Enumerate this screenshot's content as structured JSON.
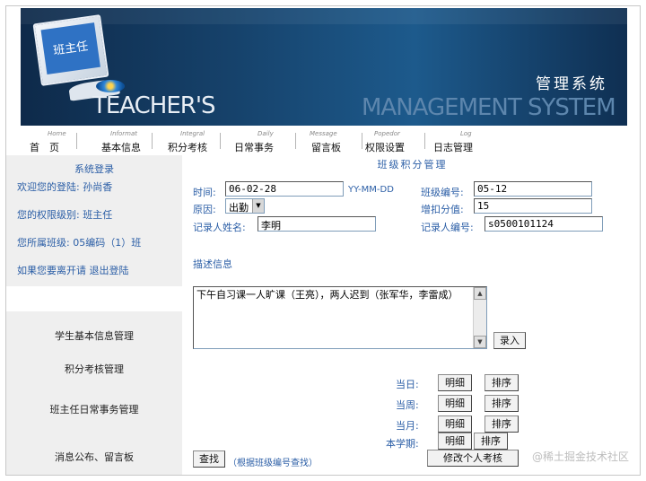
{
  "banner": {
    "monitor_text": "班主任",
    "brand_en_1": "TEACHER'S",
    "brand_en_2": "MANAGEMENT SYSTEM",
    "brand_cn": "管理系统"
  },
  "nav": {
    "items": [
      {
        "en": "Home",
        "cn": "首　页"
      },
      {
        "en": "Informat",
        "cn": "基本信息"
      },
      {
        "en": "Integral",
        "cn": "积分考核"
      },
      {
        "en": "Daily",
        "cn": "日常事务"
      },
      {
        "en": "Message",
        "cn": "留言板"
      },
      {
        "en": "Popedor",
        "cn": "权限设置"
      },
      {
        "en": "Log",
        "cn": "日志管理"
      }
    ]
  },
  "sidebar": {
    "login_title": "系统登录",
    "welcome_label": "欢迎您的登陆:",
    "welcome_user": "孙尚香",
    "level_label": "您的权限级别:",
    "level_value": "班主任",
    "class_label": "您所属班级:",
    "class_value": "05编码（1）班",
    "logout_prompt": "如果您要离开请",
    "logout_link": "退出登陆",
    "menu": [
      "学生基本信息管理",
      "积分考核管理",
      "班主任日常事务管理",
      "消息公布、留言板"
    ]
  },
  "form": {
    "title": "班级积分管理",
    "time_label": "时间:",
    "time_value": "06-02-28",
    "time_format": "YY-MM-DD",
    "class_no_label": "班级编号:",
    "class_no_value": "05-12",
    "reason_label": "原因:",
    "reason_value": "出勤",
    "score_label": "增扣分值:",
    "score_value": "15",
    "recorder_name_label": "记录人姓名:",
    "recorder_name_value": "李明",
    "recorder_id_label": "记录人编号:",
    "recorder_id_value": "s0500101124",
    "desc_label": "描述信息",
    "desc_value": "下午自习课一人旷课（王亮），两人迟到（张军华，李雷成）",
    "submit_label": "录入"
  },
  "query": {
    "rows": [
      {
        "label": "当日:",
        "detail": "明细",
        "sort": "排序"
      },
      {
        "label": "当周:",
        "detail": "明细",
        "sort": "排序"
      },
      {
        "label": "当月:",
        "detail": "明细",
        "sort": "排序"
      },
      {
        "label": "本学期:",
        "detail": "明细",
        "sort": "排序"
      }
    ],
    "modify_label": "修改个人考核",
    "search_label": "查找",
    "search_hint": "（根据班级编号查找）"
  },
  "watermark": "@稀土掘金技术社区"
}
